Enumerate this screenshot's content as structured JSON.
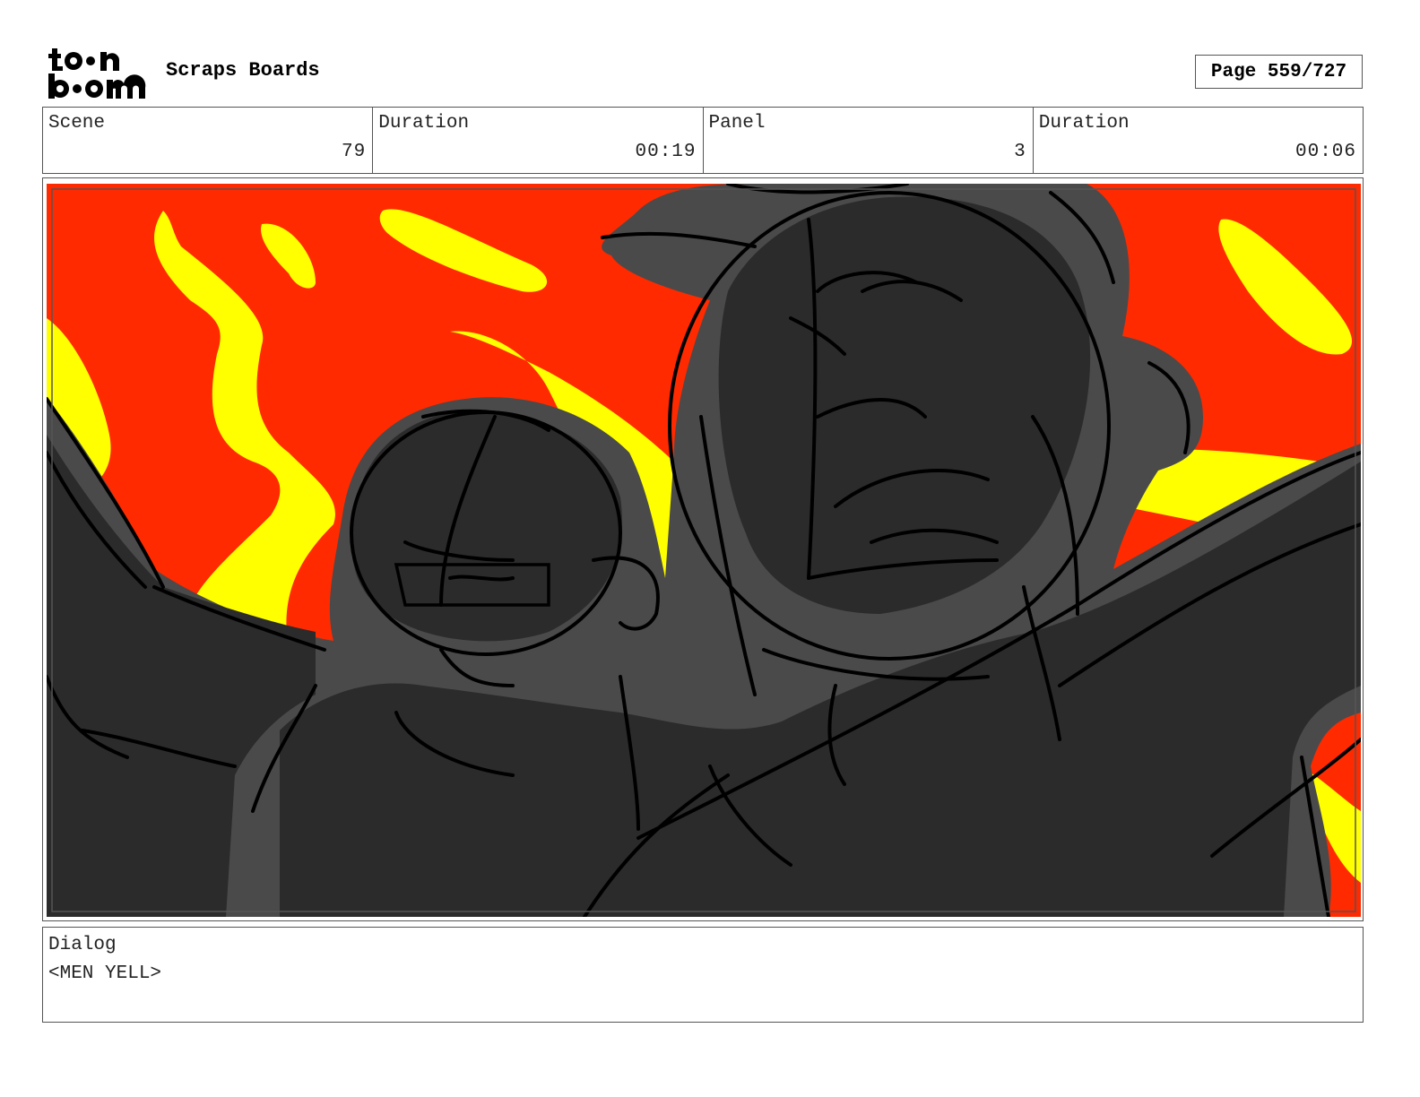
{
  "header": {
    "logo_text_top": "toon",
    "logo_text_bottom": "boom",
    "project_title": "Scraps Boards",
    "page_label": "Page 559/727"
  },
  "info": {
    "scene_label": "Scene",
    "scene_value": "79",
    "scene_duration_label": "Duration",
    "scene_duration_value": "00:19",
    "panel_label": "Panel",
    "panel_value": "3",
    "panel_duration_label": "Duration",
    "panel_duration_value": "00:06"
  },
  "dialog": {
    "label": "Dialog",
    "text": "<MEN YELL>"
  },
  "colors": {
    "fire_red": "#ff2a00",
    "fire_yellow": "#ffff00",
    "silhouette_dark": "#2b2b2b",
    "silhouette_shadow": "#4a4a4a"
  }
}
